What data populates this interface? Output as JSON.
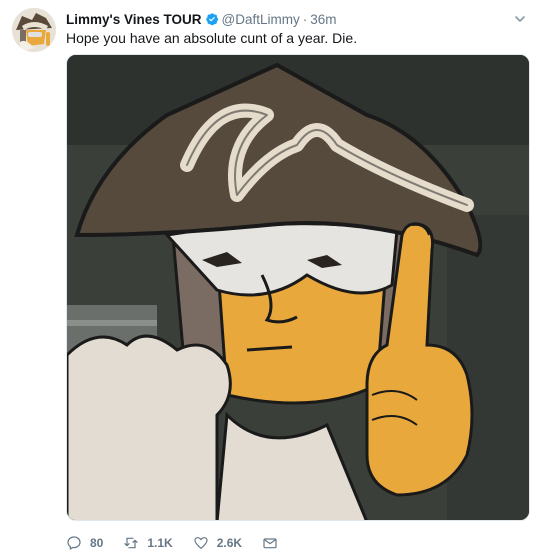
{
  "tweet": {
    "display_name": "Limmy's Vines TOUR",
    "handle": "@DaftLimmy",
    "separator": "·",
    "timestamp": "36m",
    "text": "Hope you have an absolute cunt of a year. Die.",
    "verified": true
  },
  "actions": {
    "reply_count": "80",
    "retweet_count": "1.1K",
    "like_count": "2.6K"
  },
  "icons": [
    "verified-badge-icon",
    "caret-down-icon",
    "reply-icon",
    "retweet-icon",
    "like-icon",
    "direct-message-icon"
  ],
  "colors": {
    "text_primary": "#14171a",
    "text_secondary": "#657786",
    "verified_blue": "#1da1f2"
  }
}
